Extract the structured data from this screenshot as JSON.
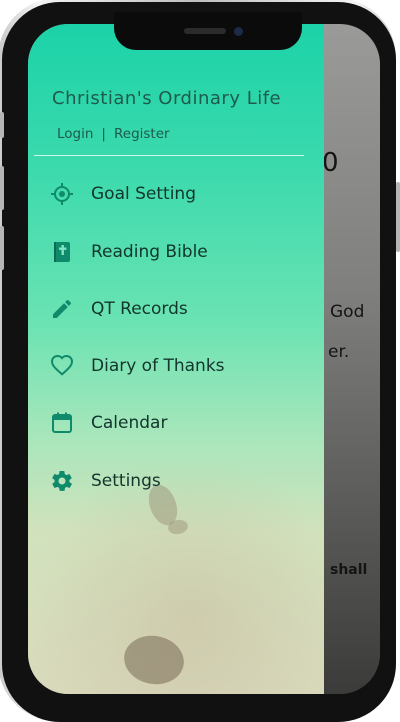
{
  "drawer": {
    "app_title": "Christian's Ordinary Life",
    "auth": {
      "login": "Login",
      "separator": "|",
      "register": "Register"
    },
    "menu": [
      {
        "label": "Goal Setting",
        "icon": "target-icon"
      },
      {
        "label": "Reading Bible",
        "icon": "bible-icon"
      },
      {
        "label": "QT Records",
        "icon": "pencil-icon"
      },
      {
        "label": "Diary of Thanks",
        "icon": "heart-icon"
      },
      {
        "label": "Calendar",
        "icon": "calendar-icon"
      },
      {
        "label": "Settings",
        "icon": "gear-icon"
      }
    ]
  },
  "background_app": {
    "number_fragment": "0",
    "text_god": "God",
    "text_er": "er.",
    "text_shall": "shall"
  },
  "colors": {
    "drawer_top": "#1cd2a8",
    "drawer_bottom": "#d9d9bc",
    "icon": "#0f8a6a",
    "text": "#12352c"
  }
}
